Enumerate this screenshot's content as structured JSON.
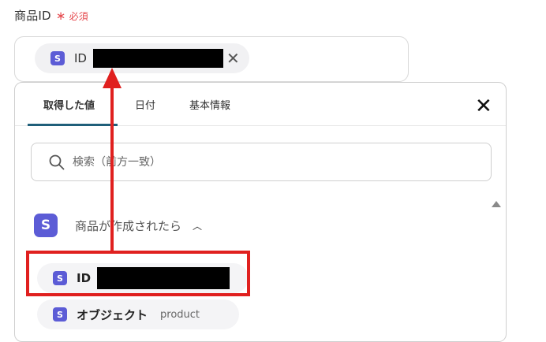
{
  "field": {
    "label": "商品ID",
    "required_star": "∗",
    "required_text": "必須",
    "chip": {
      "icon_letter": "S",
      "text": "ID",
      "close": "✕"
    }
  },
  "panel": {
    "tabs": [
      {
        "label": "取得した値",
        "active": true
      },
      {
        "label": "日付",
        "active": false
      },
      {
        "label": "基本情報",
        "active": false
      }
    ],
    "close": "✕",
    "search_placeholder": "検索（前方一致）",
    "section": {
      "icon_letter": "S",
      "title": "商品が作成されたら",
      "chevron": "︿"
    },
    "items": [
      {
        "icon_letter": "S",
        "label": "ID",
        "value": ""
      },
      {
        "icon_letter": "S",
        "label": "オブジェクト",
        "value": "product"
      }
    ]
  },
  "colors": {
    "accent": "#5c5cd6",
    "required": "#e5484d",
    "annotation": "#e0201f",
    "tab_underline": "#1f5f7a"
  },
  "icons": {
    "search": "search-icon",
    "close": "close-icon",
    "chevron": "chevron-up-icon",
    "scroll": "scroll-up-icon"
  }
}
